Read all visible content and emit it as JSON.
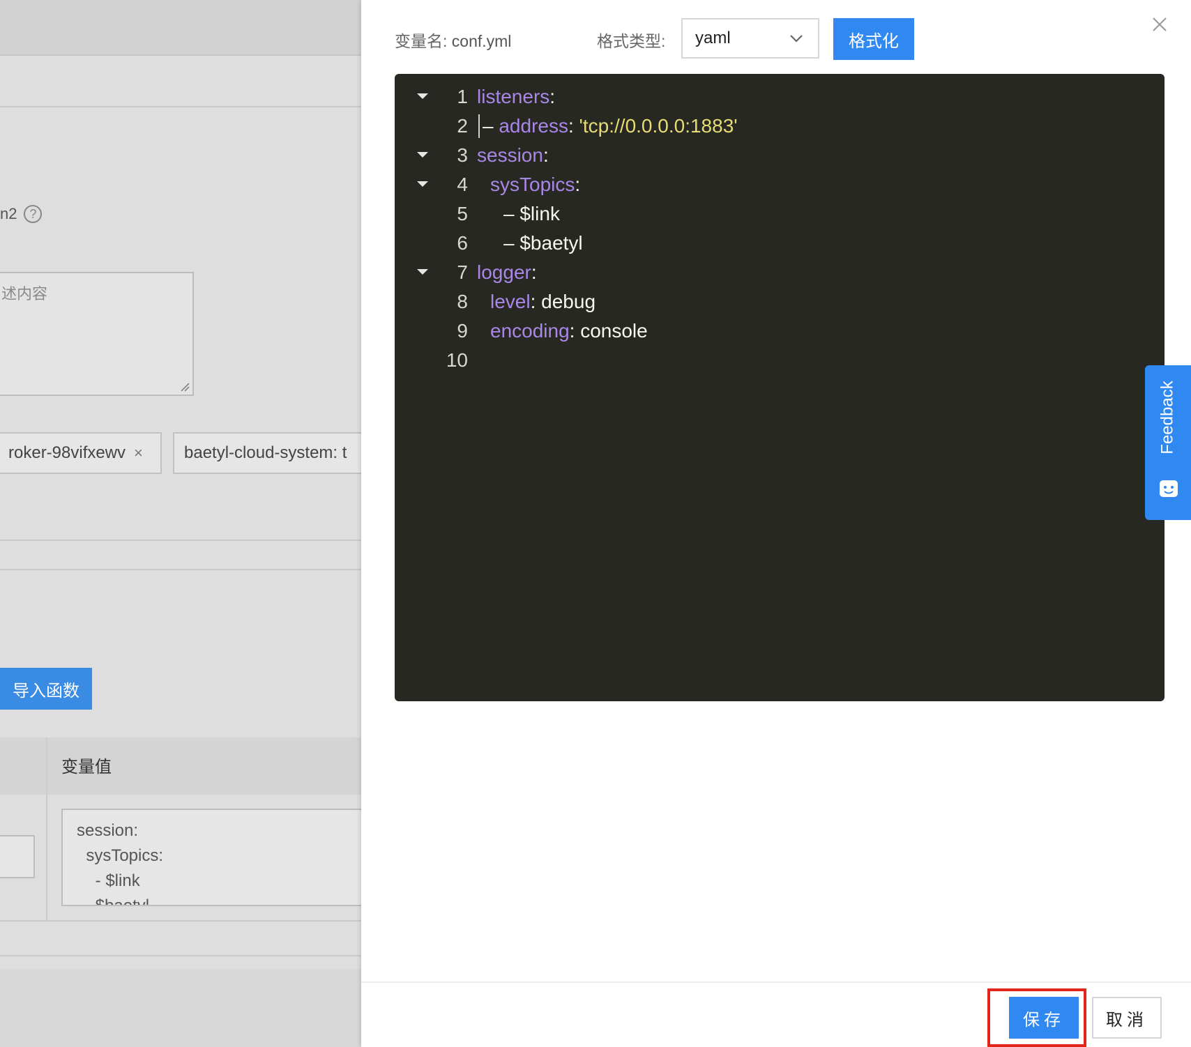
{
  "background": {
    "field_fragment": "n2",
    "help_icon": "?",
    "description_placeholder": "述内容",
    "tags": [
      {
        "label": "roker-98vifxewv",
        "remove": "×"
      },
      {
        "label": "baetyl-cloud-system: t"
      }
    ],
    "import_button": "导入函数",
    "table_header_value": "变量值",
    "value_preview": "session:\n  sysTopics:\n    - $link\n    $baetyl"
  },
  "drawer": {
    "var_name_label": "变量名:",
    "var_name_value": "conf.yml",
    "format_label": "格式类型:",
    "format_selected": "yaml",
    "format_button": "格式化",
    "close_icon": "close-icon",
    "save_button": "保存",
    "cancel_button": "取消"
  },
  "editor": {
    "lines": [
      {
        "num": "1",
        "fold": true,
        "indent": 0,
        "key": "listeners",
        "sep": ":",
        "value": "",
        "value_type": ""
      },
      {
        "num": "2",
        "fold": false,
        "indent": 0,
        "guide": true,
        "prefix": " ",
        "key": "address",
        "sep": ": ",
        "value": "'tcp://0.0.0.0:1883'",
        "value_type": "string"
      },
      {
        "num": "3",
        "fold": true,
        "indent": 0,
        "key": "session",
        "sep": ":",
        "value": "",
        "value_type": ""
      },
      {
        "num": "4",
        "fold": true,
        "indent": 1,
        "key": "sysTopics",
        "sep": ":",
        "value": "",
        "value_type": ""
      },
      {
        "num": "5",
        "fold": false,
        "indent": 2,
        "key": "",
        "sep": "",
        "value": "– $link",
        "value_type": "plain"
      },
      {
        "num": "6",
        "fold": false,
        "indent": 2,
        "key": "",
        "sep": "",
        "value": "– $baetyl",
        "value_type": "plain"
      },
      {
        "num": "7",
        "fold": true,
        "indent": 0,
        "key": "logger",
        "sep": ":",
        "value": "",
        "value_type": ""
      },
      {
        "num": "8",
        "fold": false,
        "indent": 1,
        "key": "level",
        "sep": ": ",
        "value": "debug",
        "value_type": "plain"
      },
      {
        "num": "9",
        "fold": false,
        "indent": 1,
        "key": "encoding",
        "sep": ": ",
        "value": "console",
        "value_type": "plain"
      },
      {
        "num": "10",
        "fold": false,
        "indent": 0,
        "key": "",
        "sep": "",
        "value": "",
        "value_type": ""
      }
    ]
  },
  "feedback": {
    "label": "Feedback",
    "icon": "chat-face-icon"
  },
  "colors": {
    "primary": "#2f89f0",
    "editor_bg": "#272822",
    "key": "#a887e6",
    "string": "#e6db74",
    "highlight": "#e1261c"
  }
}
